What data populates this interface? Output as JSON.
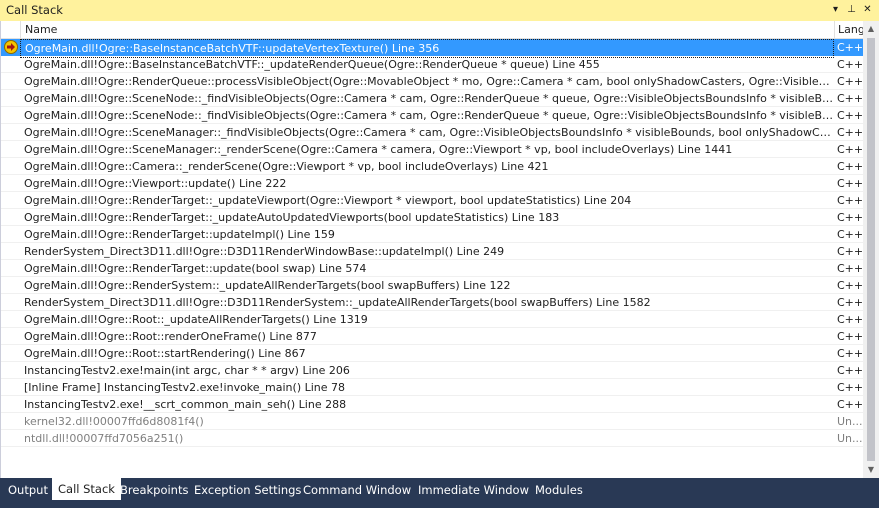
{
  "window": {
    "title": "Call Stack",
    "dropdown_glyph": "▾",
    "pin_glyph": "⊥",
    "close_glyph": "✕"
  },
  "grid": {
    "columns": {
      "name": "Name",
      "language": "Lang"
    },
    "rows": [
      {
        "name": "OgreMain.dll!Ogre::BaseInstanceBatchVTF::updateVertexTexture() Line 356",
        "language": "C++",
        "selected": true,
        "external": false
      },
      {
        "name": "OgreMain.dll!Ogre::BaseInstanceBatchVTF::_updateRenderQueue(Ogre::RenderQueue * queue) Line 455",
        "language": "C++",
        "selected": false,
        "external": false
      },
      {
        "name": "OgreMain.dll!Ogre::RenderQueue::processVisibleObject(Ogre::MovableObject * mo, Ogre::Camera * cam, bool onlyShadowCasters, Ogre::VisibleObjects...",
        "language": "C++",
        "selected": false,
        "external": false
      },
      {
        "name": "OgreMain.dll!Ogre::SceneNode::_findVisibleObjects(Ogre::Camera * cam, Ogre::RenderQueue * queue, Ogre::VisibleObjectsBoundsInfo * visibleBounds, ...",
        "language": "C++",
        "selected": false,
        "external": false
      },
      {
        "name": "OgreMain.dll!Ogre::SceneNode::_findVisibleObjects(Ogre::Camera * cam, Ogre::RenderQueue * queue, Ogre::VisibleObjectsBoundsInfo * visibleBounds, ...",
        "language": "C++",
        "selected": false,
        "external": false
      },
      {
        "name": "OgreMain.dll!Ogre::SceneManager::_findVisibleObjects(Ogre::Camera * cam, Ogre::VisibleObjectsBoundsInfo * visibleBounds, bool onlyShadowCasters) ...",
        "language": "C++",
        "selected": false,
        "external": false
      },
      {
        "name": "OgreMain.dll!Ogre::SceneManager::_renderScene(Ogre::Camera * camera, Ogre::Viewport * vp, bool includeOverlays) Line 1441",
        "language": "C++",
        "selected": false,
        "external": false
      },
      {
        "name": "OgreMain.dll!Ogre::Camera::_renderScene(Ogre::Viewport * vp, bool includeOverlays) Line 421",
        "language": "C++",
        "selected": false,
        "external": false
      },
      {
        "name": "OgreMain.dll!Ogre::Viewport::update() Line 222",
        "language": "C++",
        "selected": false,
        "external": false
      },
      {
        "name": "OgreMain.dll!Ogre::RenderTarget::_updateViewport(Ogre::Viewport * viewport, bool updateStatistics) Line 204",
        "language": "C++",
        "selected": false,
        "external": false
      },
      {
        "name": "OgreMain.dll!Ogre::RenderTarget::_updateAutoUpdatedViewports(bool updateStatistics) Line 183",
        "language": "C++",
        "selected": false,
        "external": false
      },
      {
        "name": "OgreMain.dll!Ogre::RenderTarget::updateImpl() Line 159",
        "language": "C++",
        "selected": false,
        "external": false
      },
      {
        "name": "RenderSystem_Direct3D11.dll!Ogre::D3D11RenderWindowBase::updateImpl() Line 249",
        "language": "C++",
        "selected": false,
        "external": false
      },
      {
        "name": "OgreMain.dll!Ogre::RenderTarget::update(bool swap) Line 574",
        "language": "C++",
        "selected": false,
        "external": false
      },
      {
        "name": "OgreMain.dll!Ogre::RenderSystem::_updateAllRenderTargets(bool swapBuffers) Line 122",
        "language": "C++",
        "selected": false,
        "external": false
      },
      {
        "name": "RenderSystem_Direct3D11.dll!Ogre::D3D11RenderSystem::_updateAllRenderTargets(bool swapBuffers) Line 1582",
        "language": "C++",
        "selected": false,
        "external": false
      },
      {
        "name": "OgreMain.dll!Ogre::Root::_updateAllRenderTargets() Line 1319",
        "language": "C++",
        "selected": false,
        "external": false
      },
      {
        "name": "OgreMain.dll!Ogre::Root::renderOneFrame() Line 877",
        "language": "C++",
        "selected": false,
        "external": false
      },
      {
        "name": "OgreMain.dll!Ogre::Root::startRendering() Line 867",
        "language": "C++",
        "selected": false,
        "external": false
      },
      {
        "name": "InstancingTestv2.exe!main(int argc, char * * argv) Line 206",
        "language": "C++",
        "selected": false,
        "external": false
      },
      {
        "name": "[Inline Frame] InstancingTestv2.exe!invoke_main() Line 78",
        "language": "C++",
        "selected": false,
        "external": false
      },
      {
        "name": "InstancingTestv2.exe!__scrt_common_main_seh() Line 288",
        "language": "C++",
        "selected": false,
        "external": false
      },
      {
        "name": "kernel32.dll!00007ffd6d8081f4()",
        "language": "Un...",
        "selected": false,
        "external": true
      },
      {
        "name": "ntdll.dll!00007ffd7056a251()",
        "language": "Un...",
        "selected": false,
        "external": true
      }
    ]
  },
  "tabs": [
    {
      "label": "Output",
      "active": false
    },
    {
      "label": "Call Stack",
      "active": true
    },
    {
      "label": "Breakpoints",
      "active": false
    },
    {
      "label": "Exception Settings",
      "active": false
    },
    {
      "label": "Command Window",
      "active": false
    },
    {
      "label": "Immediate Window",
      "active": false
    },
    {
      "label": "Modules",
      "active": false
    }
  ],
  "colors": {
    "title_bar": "#fff29d",
    "selection": "#3399ff",
    "tab_bar": "#293955",
    "current_frame_arrow": "#f5c400"
  },
  "icons": {
    "current_frame": "current-frame-arrow-icon",
    "scroll_up": "chevron-up-icon",
    "scroll_down": "chevron-down-icon"
  }
}
